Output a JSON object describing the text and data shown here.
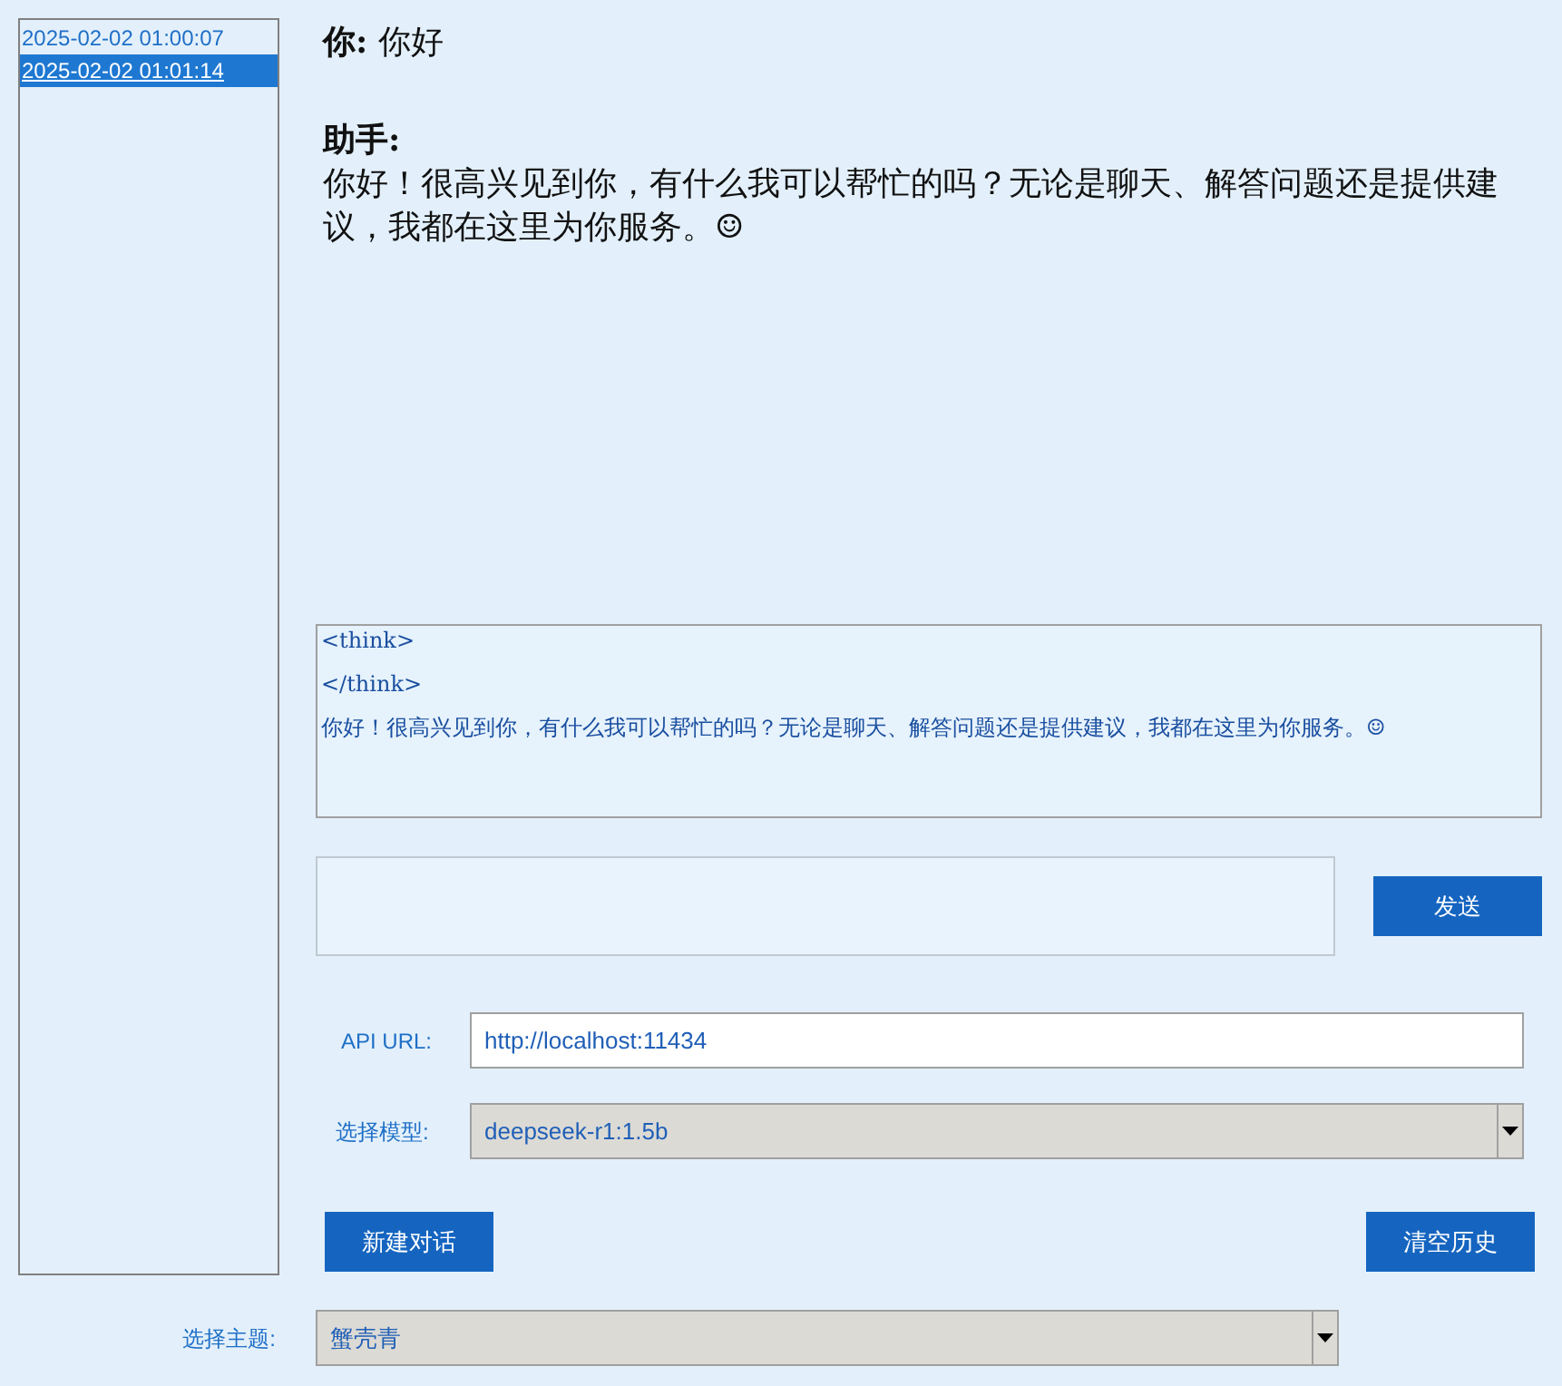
{
  "history": [
    {
      "label": "2025-02-02 01:00:07",
      "selected": false
    },
    {
      "label": "2025-02-02 01:01:14",
      "selected": true
    }
  ],
  "chat": [
    {
      "role": "你:",
      "text": "你好",
      "kind": "inline"
    },
    {
      "role": "助手:",
      "text": "你好！很高兴见到你，有什么我可以帮忙的吗？无论是聊天、解答问题还是提供建议，我都在这里为你服务。☺",
      "kind": "block"
    }
  ],
  "raw_output": {
    "lines": [
      "<think>",
      "</think>",
      "你好！很高兴见到你，有什么我可以帮忙的吗？无论是聊天、解答问题还是提供建议，我都在这里为你服务。☺"
    ]
  },
  "send_button": "发送",
  "api_url": {
    "label": "API URL:",
    "value": "http://localhost:11434"
  },
  "model": {
    "label": "选择模型:",
    "value": "deepseek-r1:1.5b"
  },
  "new_chat_button": "新建对话",
  "clear_history_button": "清空历史",
  "theme": {
    "label": "选择主题:",
    "value": "蟹壳青"
  }
}
